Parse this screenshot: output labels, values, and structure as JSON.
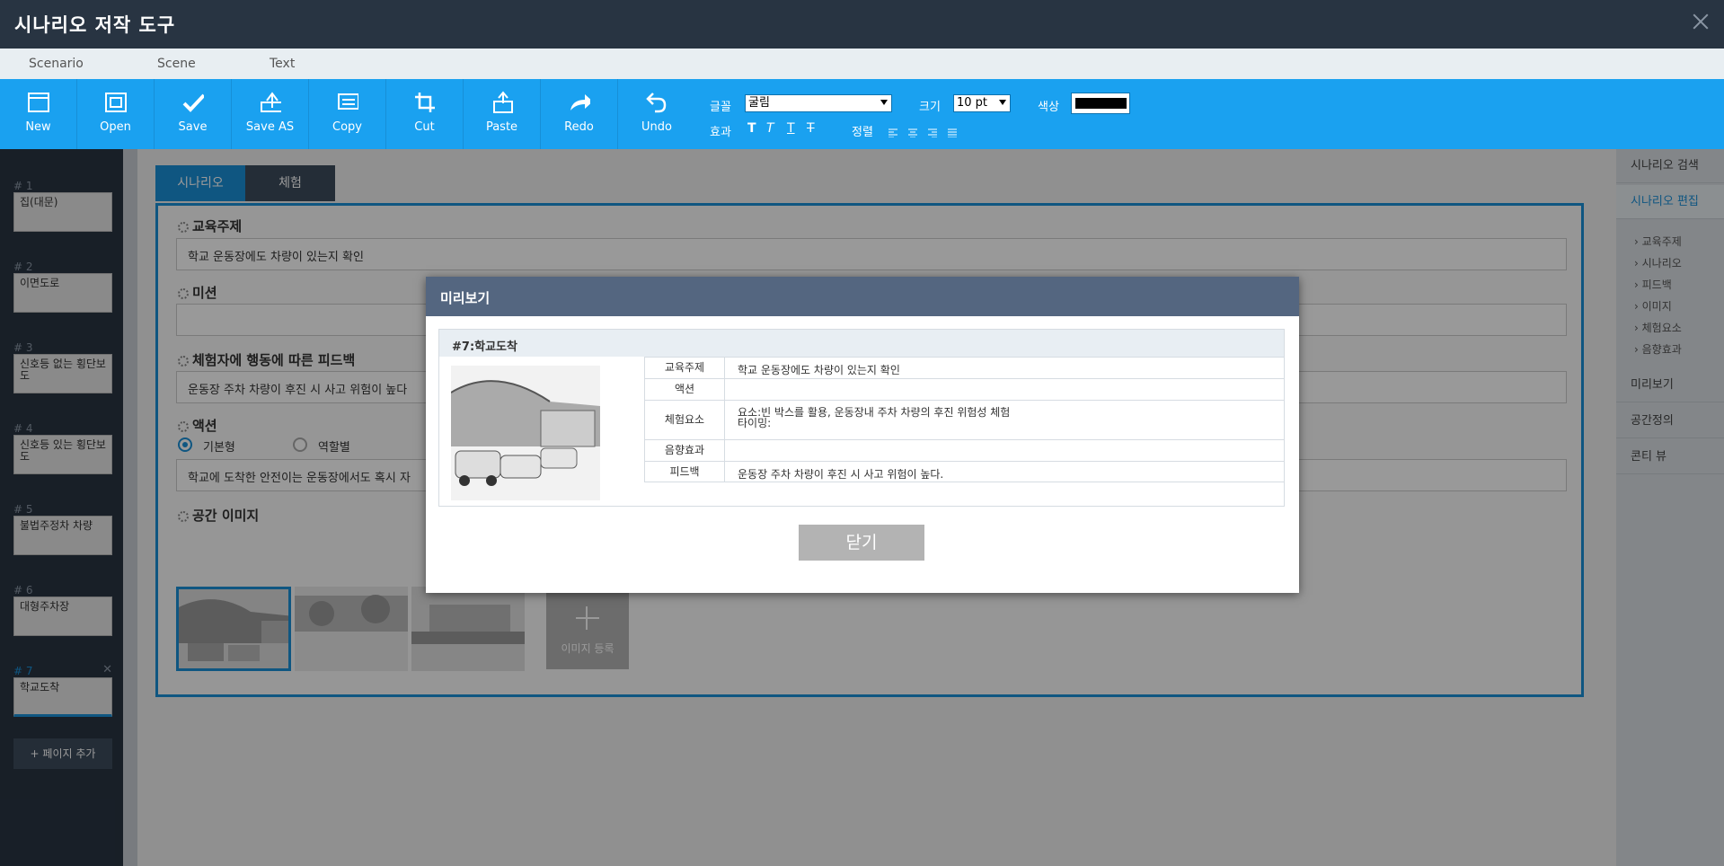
{
  "window": {
    "title": "시나리오 저작 도구"
  },
  "menu": [
    "Scenario",
    "Scene",
    "Text"
  ],
  "toolbar": {
    "buttons": [
      {
        "label": "New",
        "icon": "new-window-icon"
      },
      {
        "label": "Open",
        "icon": "open-icon"
      },
      {
        "label": "Save",
        "icon": "checkmark-icon"
      },
      {
        "label": "Save AS",
        "icon": "save-as-icon"
      },
      {
        "label": "Copy",
        "icon": "copy-icon"
      },
      {
        "label": "Cut",
        "icon": "crop-icon"
      },
      {
        "label": "Paste",
        "icon": "paste-icon"
      },
      {
        "label": "Redo",
        "icon": "redo-arrow-icon"
      },
      {
        "label": "Undo",
        "icon": "undo-arrow-icon"
      }
    ],
    "font_label": "글꼴",
    "font_value": "굴림",
    "size_label": "크기",
    "size_value": "10 pt",
    "color_label": "색상",
    "color_value": "#000000",
    "effect_label": "효과",
    "effects": [
      "T",
      "T",
      "T",
      "T"
    ],
    "align_label": "정렬"
  },
  "pages": [
    {
      "num": "# 1",
      "title": "집(대문)"
    },
    {
      "num": "# 2",
      "title": "이면도로"
    },
    {
      "num": "# 3",
      "title": "신호등 없는 횡단보도"
    },
    {
      "num": "# 4",
      "title": "신호등 있는 횡단보도"
    },
    {
      "num": "# 5",
      "title": "불법주정차 차량"
    },
    {
      "num": "# 6",
      "title": "대형주차장"
    },
    {
      "num": "# 7",
      "title": "학교도착"
    }
  ],
  "add_page_label": "+ 페이지 추가",
  "tabs": [
    "시나리오",
    "체험"
  ],
  "form": {
    "topic_label": "교육주제",
    "topic_value": "학교 운동장에도 차량이 있는지 확인",
    "mission_label": "미션",
    "mission_value": "",
    "feedback_label": "체험자에 행동에 따른 피드백",
    "feedback_value": "운동장 주차 차량이 후진 시 사고 위험이 높다",
    "action_label": "액션",
    "action_options": [
      "기본형",
      "역할별"
    ],
    "action_value": "학교에 도착한 안전이는 운동장에서도 혹시 자",
    "space_image_label": "공간 이미지",
    "image_add_label": "이미지 등록"
  },
  "rightpanel": {
    "items": [
      "시나리오 검색",
      "시나리오 편집",
      "미리보기",
      "공간정의",
      "콘티 뷰"
    ],
    "subitems": [
      "교육주제",
      "시나리오",
      "피드백",
      "이미지",
      "체험요소",
      "음향효과"
    ]
  },
  "modal": {
    "title": "미리보기",
    "scene_title": "#7:학교도착",
    "rows": [
      {
        "key": "교육주제",
        "value": "학교 운동장에도 차량이 있는지 확인"
      },
      {
        "key": "액션",
        "value": ""
      },
      {
        "key": "체험요소",
        "value": "요소:빈 박스를 활용, 운동장내 주차 차량의 후진 위험성 체험",
        "value2": "타이밍:"
      },
      {
        "key": "음향효과",
        "value": ""
      },
      {
        "key": "피드백",
        "value": "운동장 주차 차량이 후진 시 사고 위험이 높다."
      }
    ],
    "close_label": "닫기"
  },
  "colors": {
    "toolbar": "#1aa1f0",
    "titlebar": "#283442",
    "accent": "#1a8fd8",
    "modal_header": "#546680"
  }
}
